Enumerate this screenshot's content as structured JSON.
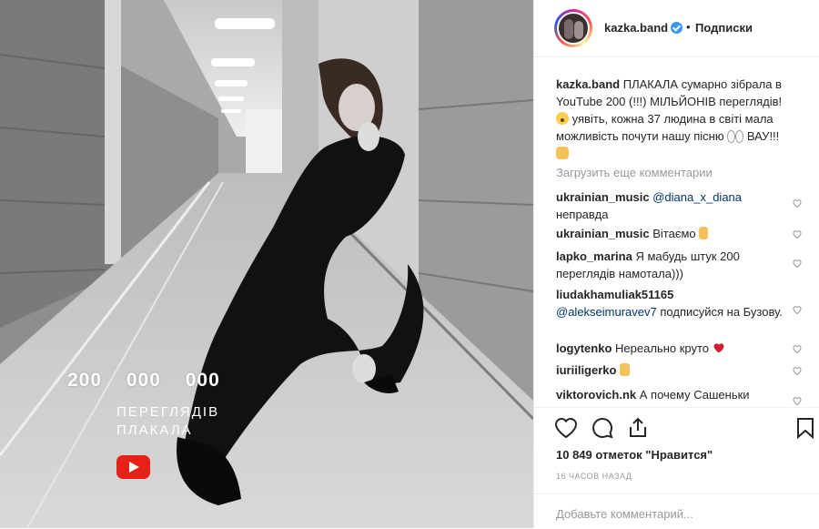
{
  "photo": {
    "overlay_count": "200 000 000",
    "overlay_line1": "ПЕРЕГЛЯДІВ",
    "overlay_line2": "ПЛАКАЛА",
    "youtube_icon": "youtube-play-icon"
  },
  "header": {
    "username": "kazka.band",
    "verified_icon": "verified-badge-icon",
    "separator": "•",
    "follow_label": "Подписки"
  },
  "caption": {
    "username": "kazka.band",
    "text1": "ПЛАКАЛА сумарно зібрала в YouTube 200 (!!!) МІЛЬЙОНІВ переглядів!",
    "text2": "уявіть, кожна 37 людина в світі мала можливість почути нашу пісню",
    "text3": "ВАУ!!!"
  },
  "load_more_label": "Загрузить еще комментарии",
  "comments": [
    {
      "user": "ukrainian_music",
      "mention": "@diana_x_diana",
      "text": "неправда"
    },
    {
      "user": "ukrainian_music",
      "text": "Вітаємо"
    },
    {
      "user": "lapko_marina",
      "text": "Я мабудь штук 200 переглядів намотала)))"
    },
    {
      "user": "liudakhamuliak51165",
      "mention": "@alekseimuravev7",
      "text": "подписуйся на Бузову."
    },
    {
      "user": "logytenko",
      "text": "Нереально круто"
    },
    {
      "user": "iuriiligerko",
      "text": ""
    },
    {
      "user": "viktorovich.nk",
      "text": "А почему Сашеньки"
    }
  ],
  "likes_label": "10 849 отметок \"Нравится\"",
  "time_label": "16 ЧАСОВ НАЗАД",
  "add_comment_placeholder": "Добавьте комментарий...",
  "icons": [
    "heart-icon",
    "comment-icon",
    "share-icon",
    "bookmark-icon",
    "comment-like-heart-icon"
  ],
  "colors": {
    "accent": "#3897f0",
    "heart_red": "#ed4956",
    "youtube_red": "#e62117",
    "mention": "#003569",
    "muted": "#999999"
  }
}
